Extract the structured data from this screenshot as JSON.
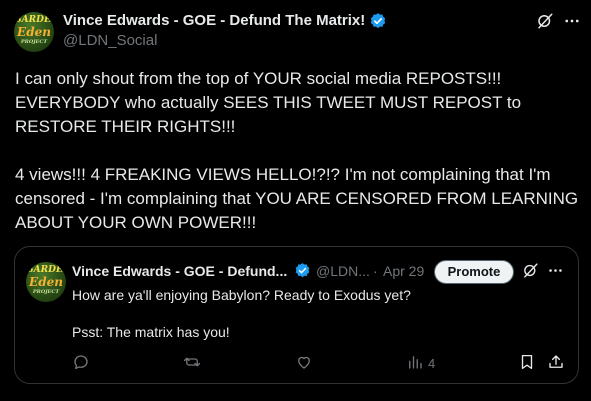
{
  "post": {
    "author_name": "Vince Edwards - GOE - Defund The Matrix!",
    "author_handle": "@LDN_Social",
    "avatar_text": [
      "GARDEN",
      "Eden",
      "PROJECT"
    ],
    "paragraph1": [
      "I can only shout from the top of YOUR social media REPOSTS!!!",
      "EVERYBODY who actually SEES THIS TWEET MUST REPOST to",
      "RESTORE THEIR RIGHTS!!!"
    ],
    "paragraph2": [
      "4 views!!! 4 FREAKING VIEWS HELLO!?!? I'm not complaining that I'm",
      "censored - I'm complaining that YOU ARE CENSORED FROM LEARNING",
      "ABOUT YOUR OWN POWER!!!"
    ]
  },
  "quote": {
    "author_name": "Vince Edwards - GOE - Defund...",
    "author_handle": "@LDN...",
    "separator": "·",
    "date": "Apr 29",
    "promote_label": "Promote",
    "line1": "How are ya'll enjoying Babylon? Ready to Exodus yet?",
    "line2": "Psst: The matrix has you!",
    "views": "4",
    "avatar_text": [
      "GARDEN",
      "Eden",
      "PROJECT"
    ]
  },
  "icons": {
    "verified": "verified-badge-icon",
    "grok": "grok-icon",
    "more": "more-icon",
    "reply": "reply-icon",
    "repost": "repost-icon",
    "like": "like-icon",
    "views": "views-icon",
    "bookmark": "bookmark-icon",
    "share": "share-icon"
  },
  "colors": {
    "background": "#000000",
    "text": "#e7e9ea",
    "muted": "#71767b",
    "verified": "#1d9bf0",
    "border": "#2f3336"
  }
}
